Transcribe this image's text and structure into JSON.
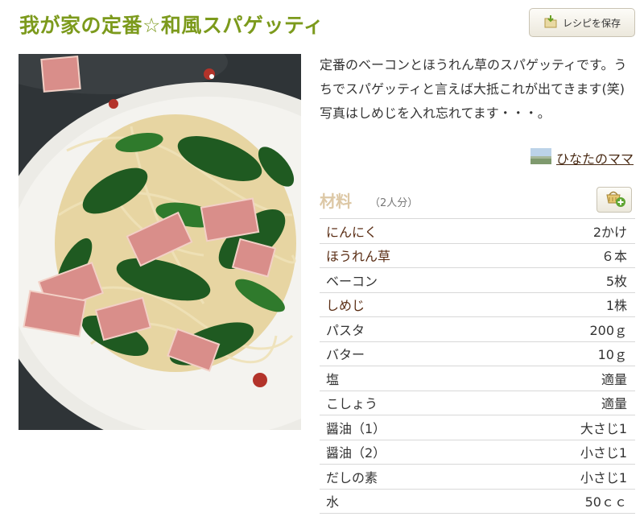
{
  "recipe": {
    "title": "我が家の定番☆和風スパゲッティ",
    "save_button": "レシピを保存",
    "description": "定番のベーコンとほうれん草のスパゲッティです。うちでスパゲッティと言えば大抵これが出てきます(笑)写真はしめじを入れ忘れてます・・・。",
    "author": "ひなたのママ",
    "photo_icon": "recipe-photo",
    "save_icon": "save-folder-icon",
    "basket_icon": "add-to-basket-icon"
  },
  "ingredients": {
    "title": "材料",
    "servings": "（2人分）",
    "items": [
      {
        "name": "にんにく",
        "qty": "2かけ",
        "link": true
      },
      {
        "name": "ほうれん草",
        "qty": "６本",
        "link": true
      },
      {
        "name": "ベーコン",
        "qty": "5枚",
        "link": false
      },
      {
        "name": "しめじ",
        "qty": "1株",
        "link": true
      },
      {
        "name": "パスタ",
        "qty": "200ｇ",
        "link": false
      },
      {
        "name": "バター",
        "qty": "10ｇ",
        "link": false
      },
      {
        "name": "塩",
        "qty": "適量",
        "link": false
      },
      {
        "name": "こしょう",
        "qty": "適量",
        "link": false
      },
      {
        "name": "醤油（1）",
        "qty": "大さじ1",
        "link": false
      },
      {
        "name": "醤油（2）",
        "qty": "小さじ1",
        "link": false
      },
      {
        "name": "だしの素",
        "qty": "小さじ1",
        "link": false
      },
      {
        "name": "水",
        "qty": "50ｃｃ",
        "link": false
      }
    ]
  },
  "colors": {
    "title": "#7c9a1c",
    "link": "#5a2d14",
    "ingredients_title": "#ddc8a6"
  }
}
